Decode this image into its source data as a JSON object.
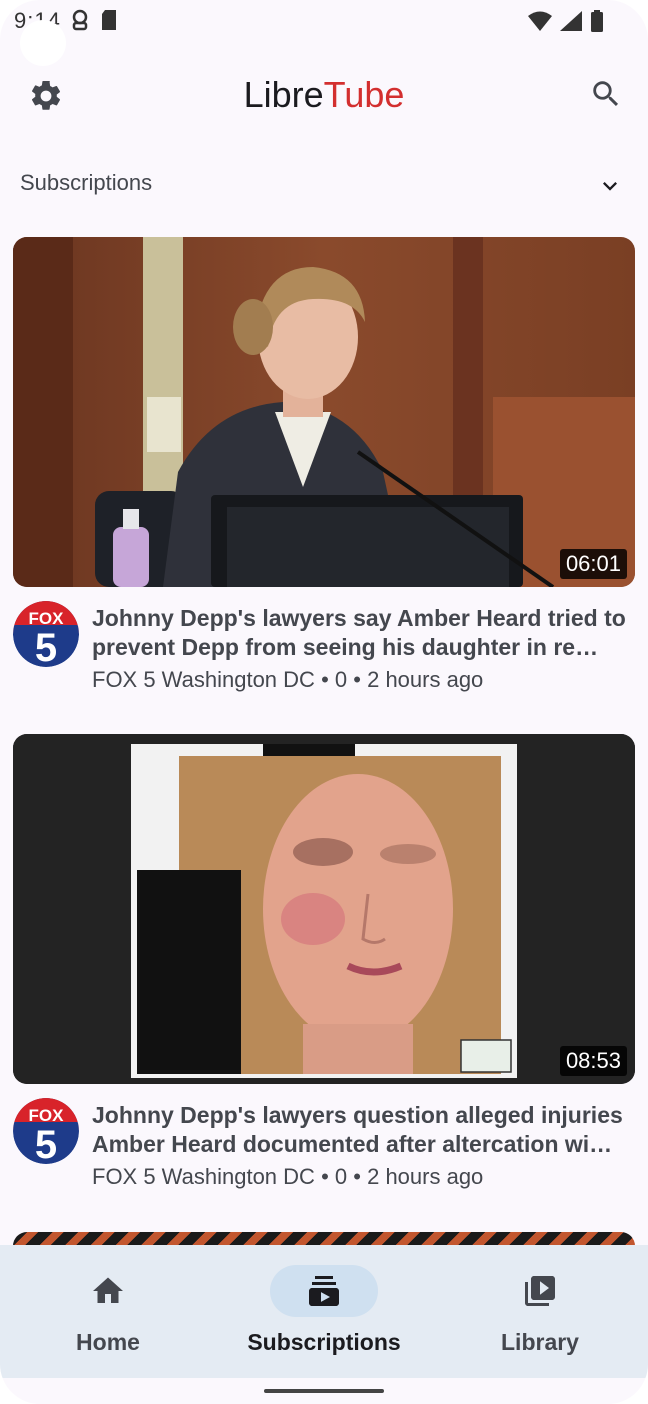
{
  "status_bar": {
    "time": "9:14"
  },
  "app": {
    "title_part1": "Libre",
    "title_part2": "Tube"
  },
  "section": {
    "label": "Subscriptions"
  },
  "videos": [
    {
      "title": "Johnny Depp's lawyers say Amber Heard tried to prevent Depp from seeing his daughter in re…",
      "channel": "FOX 5 Washington DC",
      "views": "0",
      "age": "2 hours ago",
      "duration": "06:01",
      "avatar_text_top": "FOX",
      "avatar_text_bottom": "5"
    },
    {
      "title": "Johnny Depp's lawyers question alleged injuries Amber Heard documented after altercation wi…",
      "channel": "FOX 5 Washington DC",
      "views": "0",
      "age": "2 hours ago",
      "duration": "08:53",
      "avatar_text_top": "FOX",
      "avatar_text_bottom": "5"
    }
  ],
  "meta_separator": "•",
  "nav": {
    "items": [
      {
        "label": "Home",
        "icon": "home-icon",
        "active": false
      },
      {
        "label": "Subscriptions",
        "icon": "subscriptions-icon",
        "active": true
      },
      {
        "label": "Library",
        "icon": "library-icon",
        "active": false
      }
    ]
  },
  "colors": {
    "brand_red": "#d32f2f",
    "nav_bg": "#e4ebf3",
    "active_pill": "#cfe0f0"
  }
}
